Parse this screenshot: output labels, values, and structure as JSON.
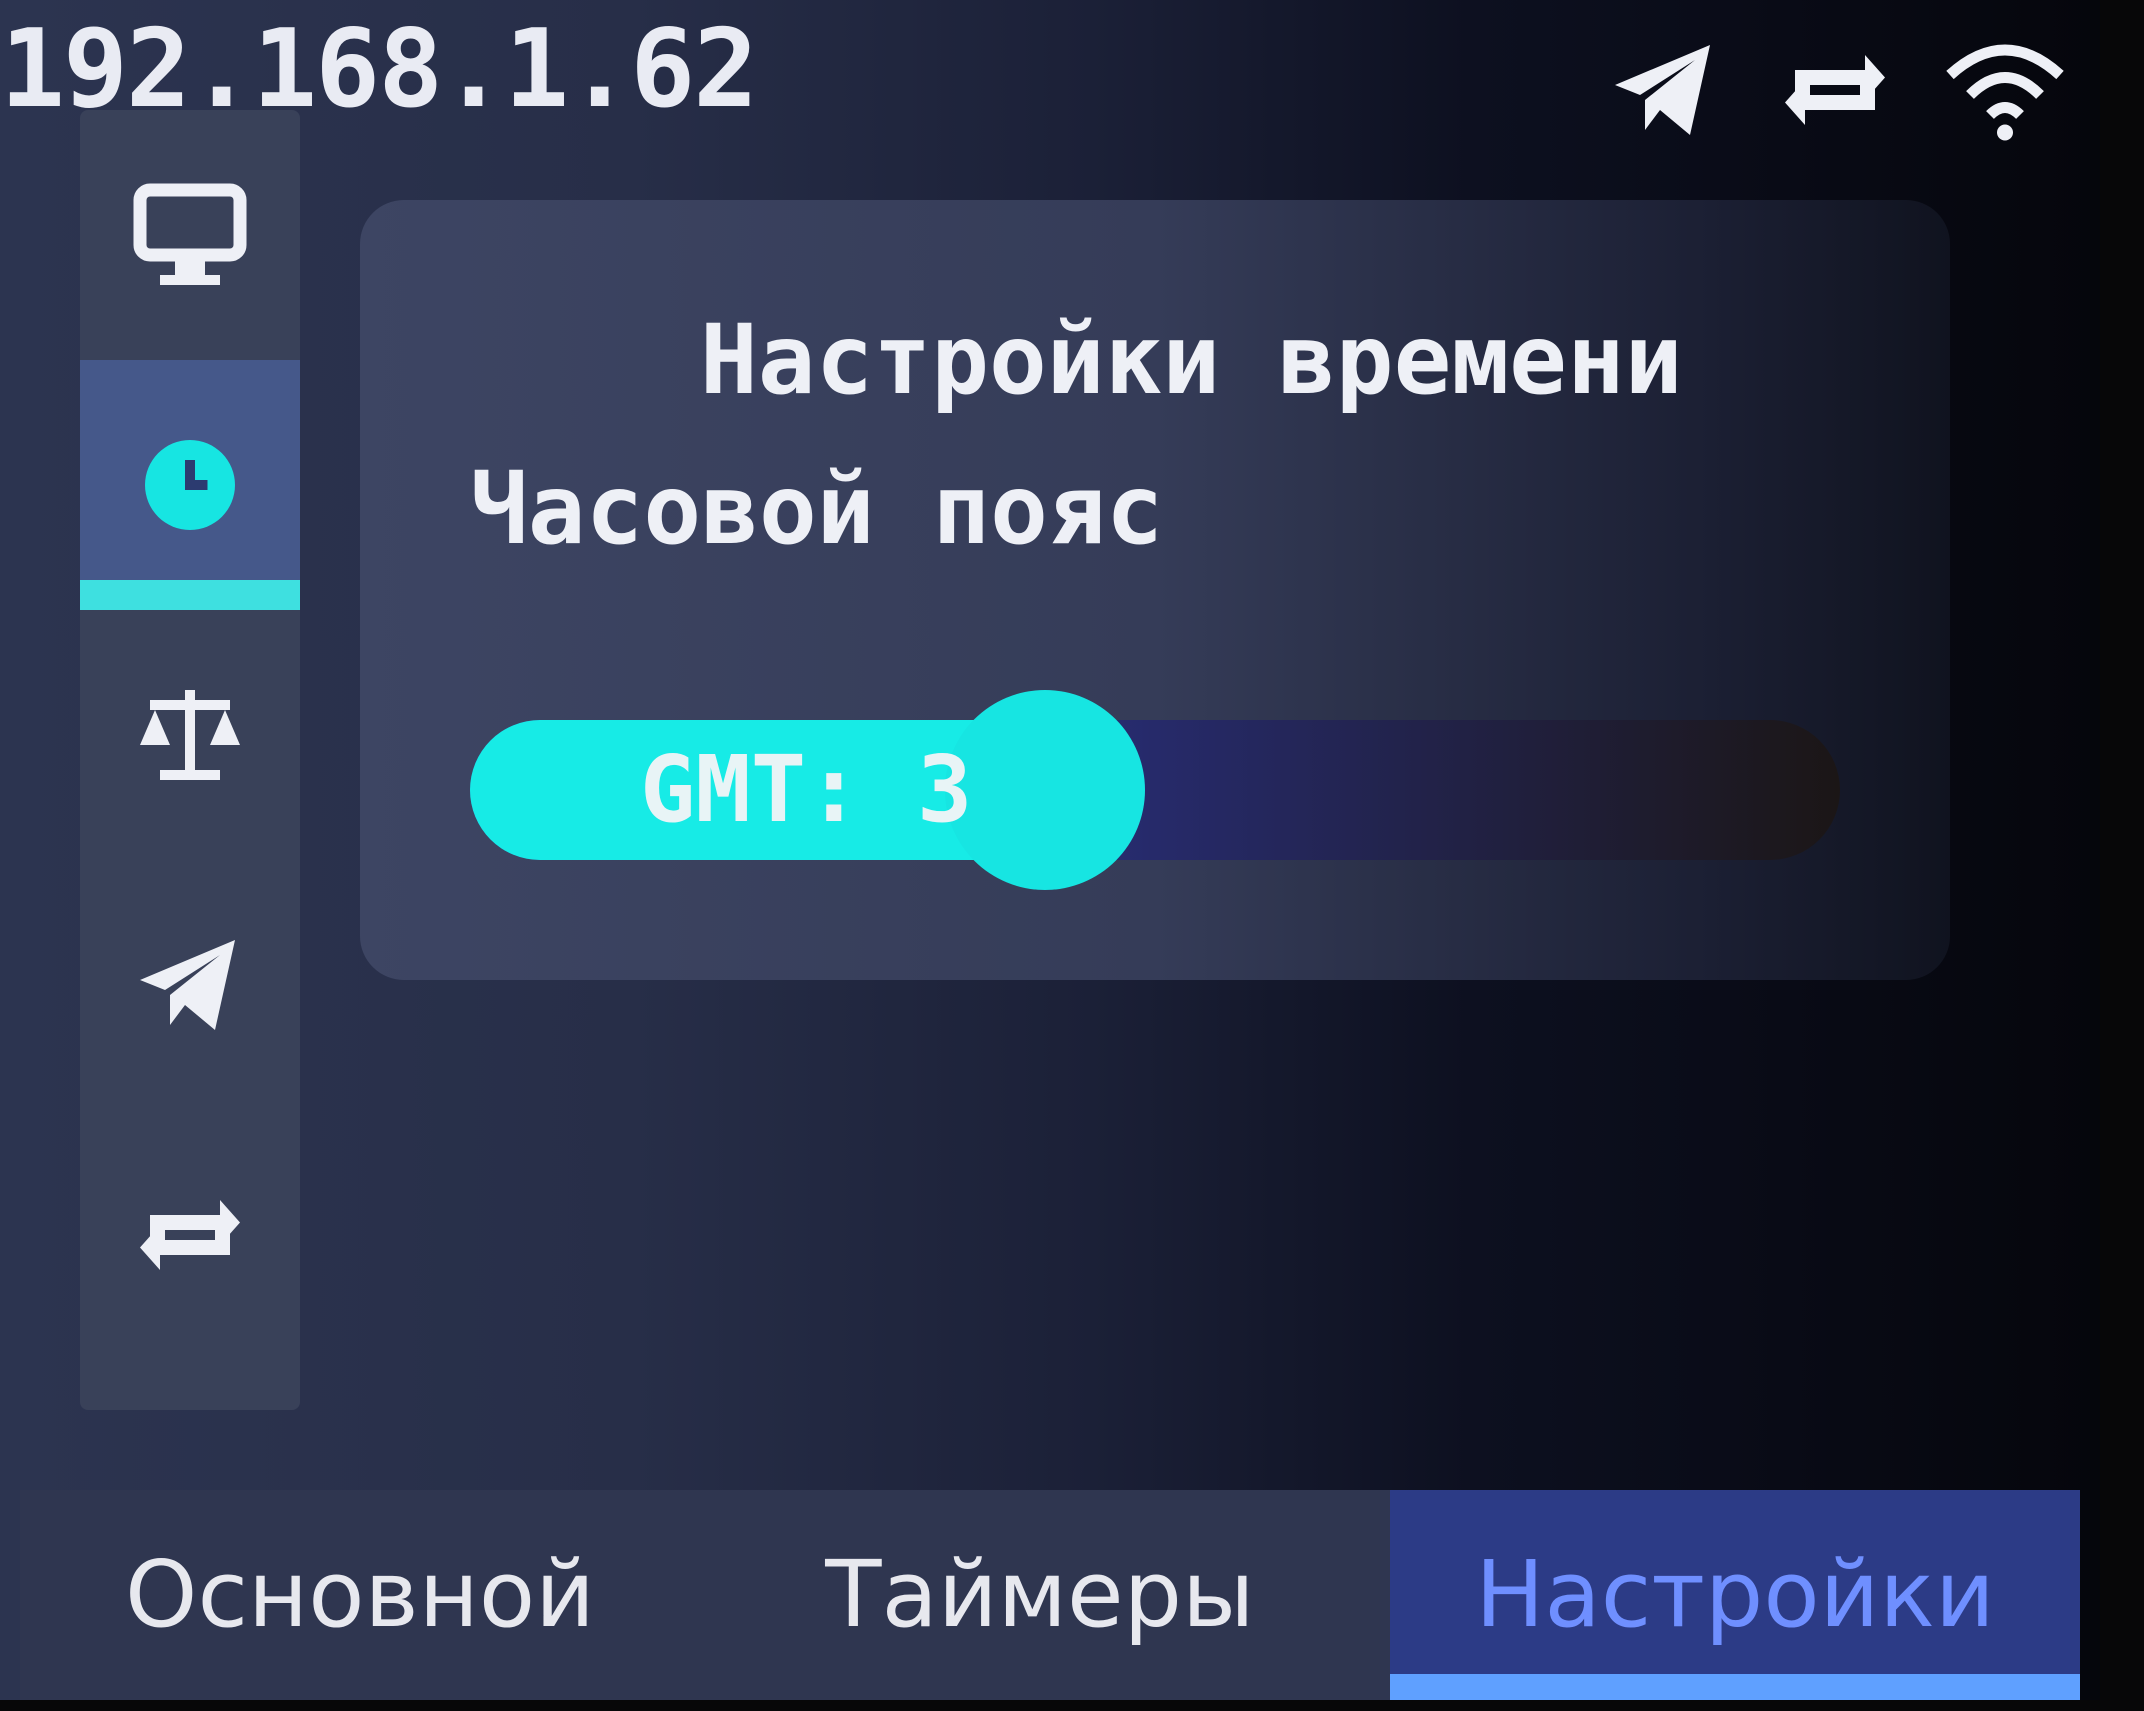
{
  "status_bar": {
    "ip_address": "192.168.1.62",
    "icons": [
      "telegram-icon",
      "sync-icon",
      "wifi-icon"
    ]
  },
  "sidebar": {
    "items": [
      {
        "icon": "monitor-icon",
        "active": false
      },
      {
        "icon": "clock-icon",
        "active": true
      },
      {
        "icon": "scale-icon",
        "active": false
      },
      {
        "icon": "telegram-icon",
        "active": false
      },
      {
        "icon": "sync-icon",
        "active": false
      }
    ]
  },
  "time_settings": {
    "title": "Настройки времени",
    "timezone_label": "Часовой пояс",
    "timezone_value_text": "GMT: 3",
    "slider_fraction": 0.42
  },
  "tabs": [
    {
      "label": "Основной",
      "active": false
    },
    {
      "label": "Таймеры",
      "active": false
    },
    {
      "label": "Настройки",
      "active": true
    }
  ],
  "colors": {
    "accent": "#17EBE6",
    "active_tab_text": "#6F8FFF",
    "active_tab_indicator": "#5FA0FF"
  }
}
